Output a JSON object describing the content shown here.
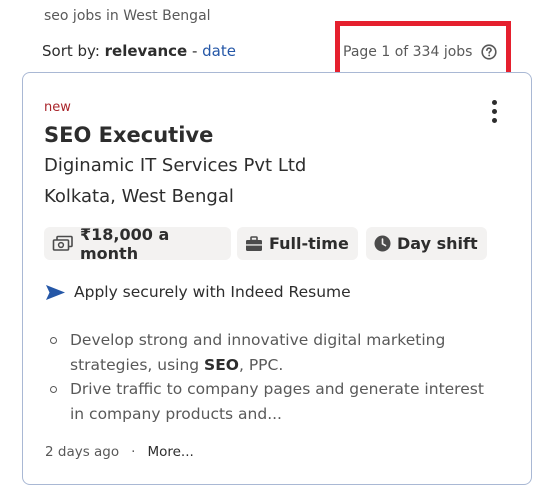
{
  "search": {
    "query_label": "seo jobs in West Bengal"
  },
  "sort": {
    "prefix": "Sort by: ",
    "active": "relevance",
    "separator": " - ",
    "alternate": "date"
  },
  "pagination": {
    "text": "Page 1 of 334 jobs"
  },
  "job": {
    "badge": "new",
    "title": "SEO Executive",
    "company": "Diginamic IT Services Pvt Ltd",
    "location": "Kolkata, West Bengal",
    "attributes": [
      {
        "icon": "salary-icon",
        "label": "₹18,000 a month"
      },
      {
        "icon": "briefcase-icon",
        "label": "Full-time"
      },
      {
        "icon": "clock-icon",
        "label": "Day shift"
      }
    ],
    "apply_text": "Apply securely with Indeed Resume",
    "snippet": [
      {
        "before": "Develop strong and innovative digital marketing strategies, using ",
        "bold": "SEO",
        "after": ", PPC."
      },
      {
        "before": "Drive traffic to company pages and generate interest in company products and...",
        "bold": "",
        "after": ""
      }
    ],
    "posted": "2 days ago",
    "footer_dot": "·",
    "more_link": "More..."
  },
  "colors": {
    "accent_blue": "#2557a7",
    "new_badge_red": "#a9252b",
    "highlight_box_red": "#e5202e",
    "card_border": "#a9b8d4",
    "chip_background": "#f3f2f1"
  }
}
